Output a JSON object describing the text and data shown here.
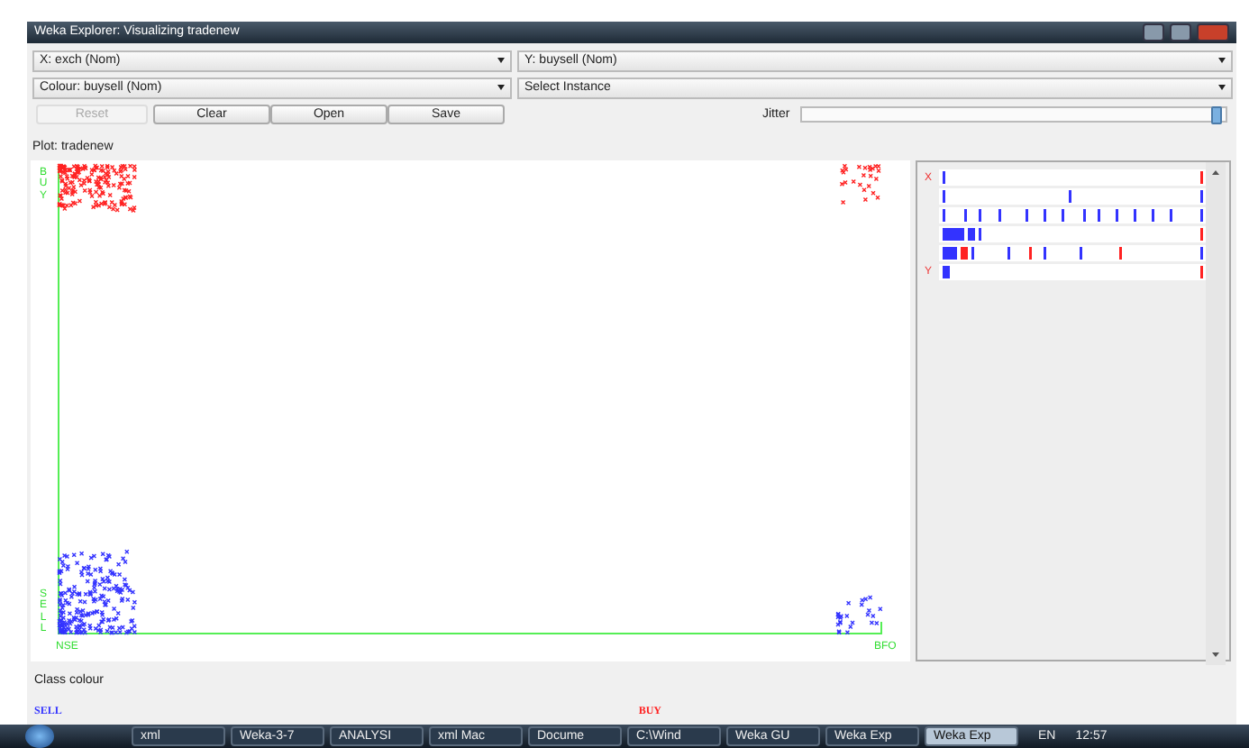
{
  "window": {
    "title": "Weka Explorer: Visualizing tradenew"
  },
  "selectors": [
    {
      "label": "X: exch (Nom)"
    },
    {
      "label": "Y: buysell (Nom)"
    },
    {
      "label": "Colour: buysell (Nom)"
    },
    {
      "label": "Select Instance"
    }
  ],
  "buttons": [
    {
      "label": "Reset",
      "disabled": true
    },
    {
      "label": "Clear",
      "disabled": false
    },
    {
      "label": "Open",
      "disabled": false
    },
    {
      "label": "Save",
      "disabled": false
    }
  ],
  "jitter": {
    "label": "Jitter",
    "level": 0.98
  },
  "plot": {
    "title": "Plot: tradenew",
    "y_labels": [
      "BUY",
      "SELL"
    ],
    "x_labels": [
      "NSE",
      "BFO"
    ]
  },
  "attribute_panel": {
    "x_marker": "X",
    "y_marker": "Y"
  },
  "class_colour": {
    "title": "Class colour",
    "classes": [
      {
        "label": "SELL",
        "color": "#3333ff"
      },
      {
        "label": "BUY",
        "color": "#ff2222"
      }
    ]
  },
  "taskbar": {
    "items": [
      {
        "label": "xml",
        "selected": false
      },
      {
        "label": "Weka-3-7",
        "selected": false
      },
      {
        "label": "ANALYSI",
        "selected": false
      },
      {
        "label": "xml Mac",
        "selected": false
      },
      {
        "label": "Docume",
        "selected": false
      },
      {
        "label": "C:\\Wind",
        "selected": false
      },
      {
        "label": "Weka GU",
        "selected": false
      },
      {
        "label": "Weka Exp",
        "selected": false
      },
      {
        "label": "Weka Exp",
        "selected": true
      }
    ],
    "language": "EN",
    "clock": "12:57"
  }
}
